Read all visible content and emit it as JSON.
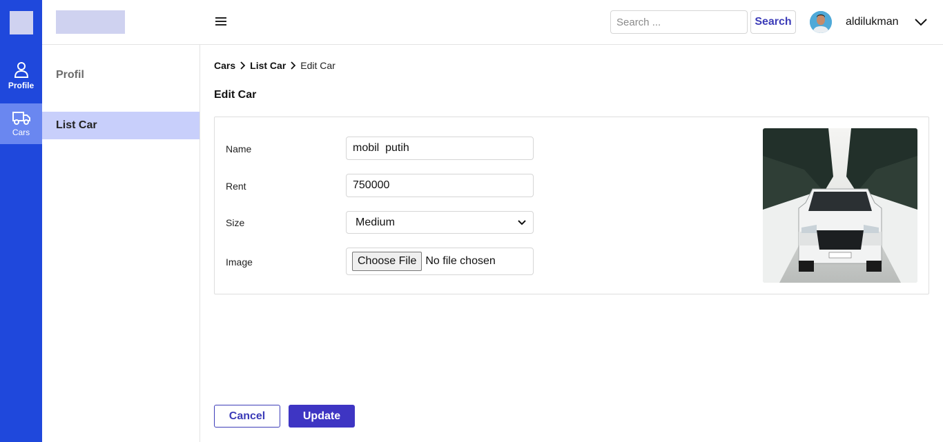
{
  "rail": {
    "items": [
      {
        "label": "Profile",
        "icon": "user-icon"
      },
      {
        "label": "Cars",
        "icon": "truck-icon"
      }
    ]
  },
  "header": {
    "search_placeholder": "Search ...",
    "search_label": "Search",
    "username": "aldilukman"
  },
  "subnav": {
    "title": "Profil",
    "items": [
      {
        "label": "List Car"
      }
    ]
  },
  "breadcrumb": [
    "Cars",
    "List Car",
    "Edit Car"
  ],
  "page_title": "Edit Car",
  "form": {
    "name_label": "Name",
    "name_value": "mobil  putih",
    "rent_label": "Rent",
    "rent_value": "750000",
    "size_label": "Size",
    "size_value": "Medium",
    "image_label": "Image",
    "choose_file_label": "Choose File",
    "file_status": "No file chosen"
  },
  "actions": {
    "cancel_label": "Cancel",
    "update_label": "Update"
  },
  "colors": {
    "rail": "#1f48dc",
    "rail_active": "#6a87f0",
    "subnav_active": "#c8cffb",
    "accent": "#3e35c3"
  }
}
